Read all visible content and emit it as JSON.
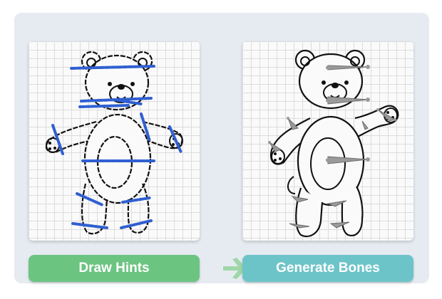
{
  "steps": [
    {
      "label": "Draw Hints",
      "color": "#6cc481"
    },
    {
      "label": "Generate Bones",
      "color": "#6dc4c8"
    }
  ],
  "arrow": {
    "icon": "right-arrow-icon",
    "color": "#9fd7a8"
  },
  "colors": {
    "hint_stroke": "#2f5fd1",
    "bone_fill": "#9a9a9a",
    "outline": "#111111"
  }
}
